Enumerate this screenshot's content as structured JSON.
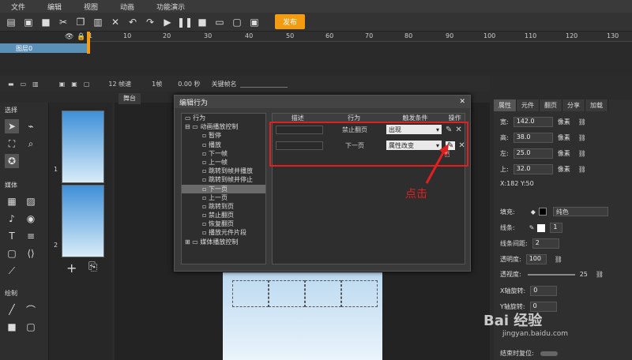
{
  "menu": [
    "文件",
    "编辑",
    "视图",
    "动画",
    "功能演示"
  ],
  "toolbar": {
    "publish": "发布"
  },
  "timeline": {
    "ticks": [
      "1",
      "10",
      "20",
      "30",
      "40",
      "50",
      "60",
      "70",
      "80",
      "90",
      "100",
      "110",
      "120",
      "130"
    ],
    "layer": "图层0",
    "fps": "12 帧速",
    "frame": "1帧",
    "time": "0.00 秒",
    "keyframe_name": "关键帧名"
  },
  "left": {
    "select": "选择",
    "media": "媒体",
    "draw": "绘制"
  },
  "thumbs": {
    "page1": "1",
    "page2": "2"
  },
  "stage_tab": "舞台",
  "dialog": {
    "title": "编辑行为",
    "close": "✕",
    "tree": [
      {
        "label": "行为",
        "level": 0
      },
      {
        "label": "动画播放控制",
        "level": 1
      },
      {
        "label": "暂停",
        "level": 2
      },
      {
        "label": "播放",
        "level": 2
      },
      {
        "label": "下一帧",
        "level": 2
      },
      {
        "label": "上一帧",
        "level": 2
      },
      {
        "label": "跳转到帧并播放",
        "level": 2
      },
      {
        "label": "跳转到帧并停止",
        "level": 2
      },
      {
        "label": "下一页",
        "level": 2,
        "selected": true
      },
      {
        "label": "上一页",
        "level": 2
      },
      {
        "label": "跳转到页",
        "level": 2
      },
      {
        "label": "禁止翻页",
        "level": 2
      },
      {
        "label": "恢复翻页",
        "level": 2
      },
      {
        "label": "播放元件片段",
        "level": 2
      },
      {
        "label": "媒体播放控制",
        "level": 1
      }
    ],
    "columns": [
      "描述",
      "行为",
      "触发条件",
      "操作"
    ],
    "rows": [
      {
        "behavior": "禁止翻页",
        "trigger": "出现"
      },
      {
        "behavior": "下一页",
        "trigger": "属性改变"
      }
    ]
  },
  "right": {
    "tabs": [
      "属性",
      "元件",
      "翻页",
      "分享",
      "加载"
    ],
    "width_label": "宽:",
    "width": "142.0",
    "height_label": "高:",
    "height": "38.0",
    "left_label": "左:",
    "left": "25.0",
    "top_label": "上:",
    "top": "32.0",
    "unit": "像素",
    "coords": "X:182   Y:50",
    "fill_label": "填充:",
    "fill_value": "纯色",
    "stroke_label": "线条:",
    "stroke_width": "1",
    "spacing_label": "线条间距:",
    "spacing": "2",
    "opacity_label": "透明度:",
    "opacity": "100",
    "visibility_label": "透视度:",
    "visibility": "25",
    "xrot_label": "X轴旋转:",
    "xrot": "0",
    "yrot_label": "Y轴旋转:",
    "yrot": "0",
    "reset_label": "结束时复位:"
  },
  "annotation": "点击",
  "watermark": {
    "main": "Bai 经验",
    "sub": "jingyan.baidu.com"
  }
}
